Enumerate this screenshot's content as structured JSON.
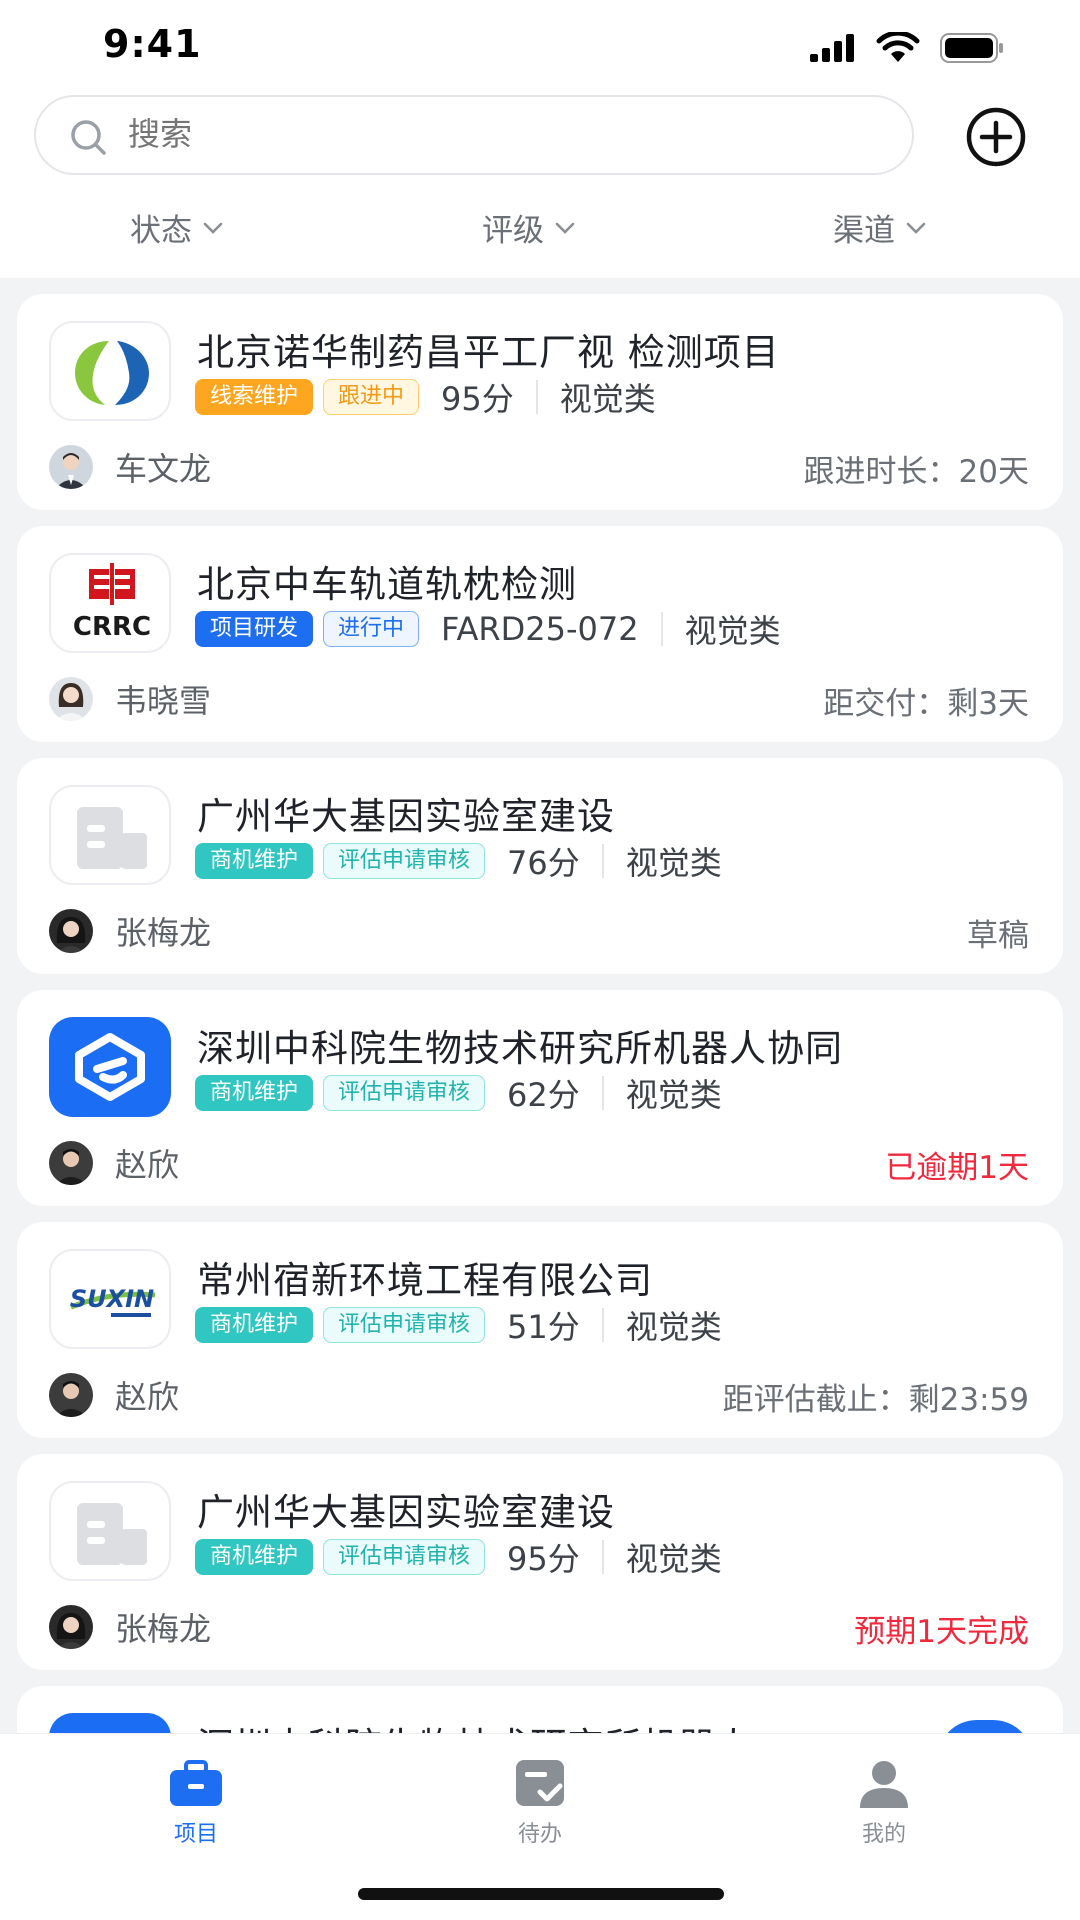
{
  "status_bar": {
    "time": "9:41"
  },
  "search": {
    "placeholder": "搜索"
  },
  "filters": [
    {
      "label": "状态"
    },
    {
      "label": "评级"
    },
    {
      "label": "渠道"
    }
  ],
  "cards": [
    {
      "title": "北京诺华制药昌平工厂视 检测项目",
      "logo": "novartis-logo",
      "tags": [
        "线索维护",
        "跟进中"
      ],
      "score": "95分",
      "type": "视觉类",
      "owner": "车文龙",
      "right_info": "跟进时长：20天"
    },
    {
      "title": "北京中车轨道轨枕检测",
      "logo": "crrc-logo",
      "logo_text": "CRRC",
      "tags": [
        "项目研发",
        "进行中"
      ],
      "score": "FARD25-072",
      "type": "视觉类",
      "owner": "韦晓雪",
      "right_info": "距交付：剩3天"
    },
    {
      "title": "广州华大基因实验室建设",
      "logo": "building-placeholder-icon",
      "tags": [
        "商机维护",
        "评估申请审核"
      ],
      "score": "76分",
      "type": "视觉类",
      "owner": "张梅龙",
      "right_info": "草稿"
    },
    {
      "title": "深圳中科院生物技术研究所机器人协同",
      "logo": "e-logo",
      "tags": [
        "商机维护",
        "评估申请审核"
      ],
      "score": "62分",
      "type": "视觉类",
      "owner": "赵欣",
      "right_info": "已逾期1天"
    },
    {
      "title": "常州宿新环境工程有限公司",
      "logo": "suxin-logo",
      "logo_text": "SUXIN",
      "tags": [
        "商机维护",
        "评估申请审核"
      ],
      "score": "51分",
      "type": "视觉类",
      "owner": "赵欣",
      "right_info": "距评估截止：剩23:59"
    },
    {
      "title": "广州华大基因实验室建设",
      "logo": "building-placeholder-icon",
      "tags": [
        "商机维护",
        "评估申请审核"
      ],
      "score": "95分",
      "type": "视觉类",
      "owner": "张梅龙",
      "right_info": "预期1天完成"
    },
    {
      "title": "深圳中科院生物技术研究所机器人",
      "logo": "e-logo"
    }
  ],
  "tabbar": [
    {
      "label": "项目",
      "icon": "briefcase-icon",
      "active": true
    },
    {
      "label": "待办",
      "icon": "todo-icon",
      "active": false
    },
    {
      "label": "我的",
      "icon": "user-icon",
      "active": false
    }
  ],
  "colors": {
    "primary": "#1d6ef0",
    "warning_red": "#f0293d",
    "teal": "#30c6c1",
    "orange": "#ffa620"
  }
}
